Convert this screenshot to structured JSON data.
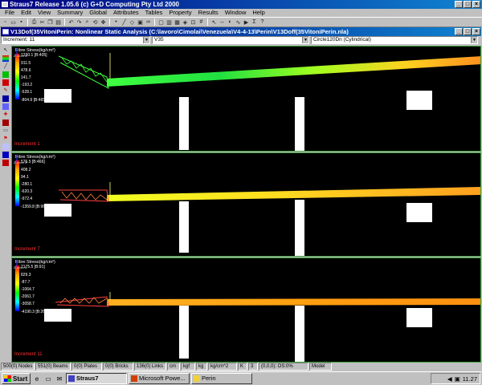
{
  "window": {
    "title": "Straus7 Release 1.05.6 (c) G+D Computing Pty Ltd 2000"
  },
  "menu": [
    "File",
    "Edit",
    "View",
    "Summary",
    "Global",
    "Attributes",
    "Tables",
    "Property",
    "Results",
    "Window",
    "Help"
  ],
  "child_window": {
    "title": "V13Dof(35VitoniPerin: Nonlinear Static Analysis (C:\\lavoro\\Cimolai\\Venezuela\\V4-4-13\\Perin\\V13Doff(35VitoniPerin.nla)"
  },
  "selectors": {
    "increment": "Increment: 11",
    "variable": "V35",
    "coordinate": "Circle120Dn (Cylindrical)"
  },
  "viewports": [
    {
      "legend_title": "Fibre Stress(kg/cm²)",
      "values": [
        "1230.1 [B:405]",
        "911.5",
        "478.6",
        "141.7",
        "-193.2",
        "-528.1",
        "-804.9 [B:465]"
      ],
      "increment_label": "Increment 1"
    },
    {
      "legend_title": "Fibre Stress(kg/cm²)",
      "values": [
        "576.5 [B:466]",
        "408.2",
        "94.1",
        "-280.1",
        "-620.3",
        "-972.4",
        "-1359.8 [B:96]"
      ],
      "increment_label": "Increment 7"
    },
    {
      "legend_title": "Fibre Stress(kg/cm²)",
      "values": [
        "2175.5 [B:91]",
        "829.3",
        "-87.7",
        "-1064.7",
        "-2061.7",
        "-3058.7",
        "-4190.3 [B:260]"
      ],
      "increment_label": "Increment 11"
    }
  ],
  "status": [
    "500(0) Nodes",
    "551(0) Beams",
    "0(0) Plates",
    "0(0) Bricks",
    "136(0) Links",
    "cm",
    "kgf",
    "kg",
    "kg/cm^2",
    "K",
    "3",
    "(0,0,0): OS:0%",
    "Model"
  ],
  "taskbar": {
    "start": "Start",
    "tasks": [
      "Straus7",
      "Microsoft Powe...",
      "Perin"
    ],
    "clock": "11.27"
  },
  "colors": {
    "titlebar": "#000080",
    "viewport_bg": "#000000",
    "frame_green": "#40a040",
    "increment_text": "#ff3030"
  }
}
